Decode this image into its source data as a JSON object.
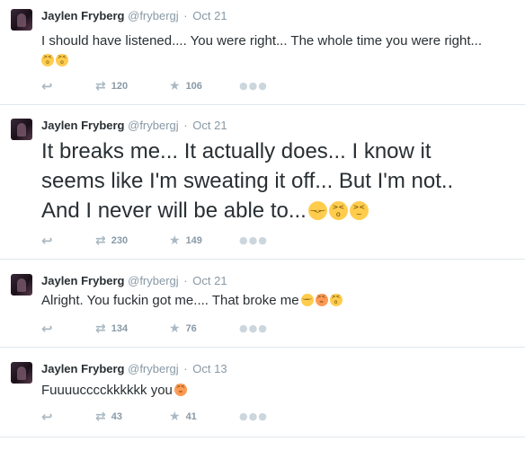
{
  "tweets": [
    {
      "name": "Jaylen Fryberg",
      "handle": "@frybergj",
      "separator": "·",
      "time": "Oct 21",
      "text": "I should have listened.... You were right... The whole time you were right...",
      "emojis": [
        "tired-face",
        "tired-face"
      ],
      "retweets": "120",
      "favorites": "106"
    },
    {
      "name": "Jaylen Fryberg",
      "handle": "@frybergj",
      "separator": "·",
      "time": "Oct 21",
      "text_lines": [
        "It breaks me... It actually does... I know it",
        "seems like I'm sweating it off... But I'm not..",
        "And I never will be able to..."
      ],
      "emojis": [
        "pensive-face",
        "tired-face",
        "confounded-face"
      ],
      "retweets": "230",
      "favorites": "149"
    },
    {
      "name": "Jaylen Fryberg",
      "handle": "@frybergj",
      "separator": "·",
      "time": "Oct 21",
      "text": "Alright. You fuckin got me.... That broke me",
      "emojis": [
        "pensive-face",
        "triumph-face",
        "tired-face"
      ],
      "retweets": "134",
      "favorites": "76"
    },
    {
      "name": "Jaylen Fryberg",
      "handle": "@frybergj",
      "separator": "·",
      "time": "Oct 13",
      "text": "Fuuuucccckkkkkk you",
      "emojis": [
        "triumph-face"
      ],
      "retweets": "43",
      "favorites": "41"
    }
  ],
  "icons": {
    "reply": "reply-icon",
    "retweet": "retweet-icon",
    "favorite": "star-icon",
    "more": "more-icon"
  },
  "colors": {
    "text": "#292f33",
    "muted": "#8899a6",
    "divider": "#e1e8ed",
    "emoji": "#ffcc4d"
  }
}
